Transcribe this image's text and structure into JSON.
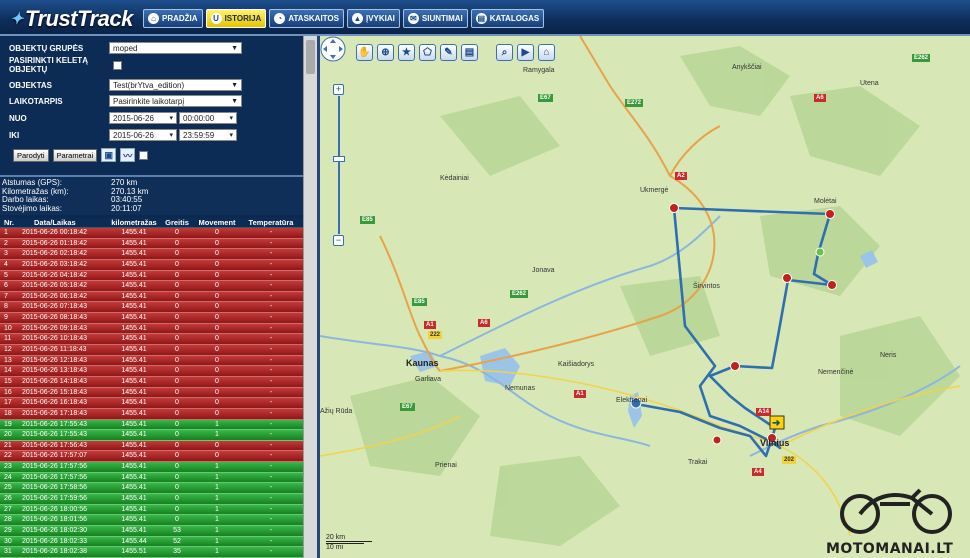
{
  "app": {
    "name": "TrustTrack"
  },
  "nav": [
    {
      "label": "PRADŽIA",
      "icon": "home-icon",
      "active": false
    },
    {
      "label": "ISTORIJA",
      "icon": "history-icon",
      "active": true
    },
    {
      "label": "ATASKAITOS",
      "icon": "report-icon",
      "active": false
    },
    {
      "label": "ĮVYKIAI",
      "icon": "alert-icon",
      "active": false
    },
    {
      "label": "SIUNTIMAI",
      "icon": "mail-icon",
      "active": false
    },
    {
      "label": "KATALOGAS",
      "icon": "catalog-icon",
      "active": false
    }
  ],
  "filters": {
    "group_label": "OBJEKTŲ GRUPĖS",
    "group_value": "moped",
    "multi_label": "PASIRINKTI KELETĄ OBJEKTŲ",
    "object_label": "OBJEKTAS",
    "object_value": "Test(brYtva_edition)",
    "period_label": "LAIKOTARPIS",
    "period_value": "Pasirinkite laikotarpį",
    "from_label": "NUO",
    "from_date": "2015-06-26",
    "from_time": "00:00:00",
    "to_label": "IKI",
    "to_date": "2015-06-26",
    "to_time": "23:59:59",
    "show_button": "Parodyti",
    "params_button": "Parametrai"
  },
  "stats": [
    {
      "key": "Atstumas (GPS):",
      "value": "270 km"
    },
    {
      "key": "Kilometražas (km):",
      "value": "270.13 km"
    },
    {
      "key": "Darbo laikas:",
      "value": "03:40:55"
    },
    {
      "key": "Stovėjimo laikas:",
      "value": "20:11:07"
    }
  ],
  "table": {
    "headers": [
      "Nr.",
      "Data/Laikas",
      "kilometražas",
      "Greitis",
      "Movement",
      "Temperatūra"
    ],
    "rows": [
      {
        "nr": "1",
        "dt": "2015-06-26 00:18:42",
        "km": "1455.41",
        "speed": "0",
        "mov": "0",
        "temp": "-",
        "status": "red"
      },
      {
        "nr": "2",
        "dt": "2015-06-26 01:18:42",
        "km": "1455.41",
        "speed": "0",
        "mov": "0",
        "temp": "-",
        "status": "red"
      },
      {
        "nr": "3",
        "dt": "2015-06-26 02:18:42",
        "km": "1455.41",
        "speed": "0",
        "mov": "0",
        "temp": "-",
        "status": "red"
      },
      {
        "nr": "4",
        "dt": "2015-06-26 03:18:42",
        "km": "1455.41",
        "speed": "0",
        "mov": "0",
        "temp": "-",
        "status": "red"
      },
      {
        "nr": "5",
        "dt": "2015-06-26 04:18:42",
        "km": "1455.41",
        "speed": "0",
        "mov": "0",
        "temp": "-",
        "status": "red"
      },
      {
        "nr": "6",
        "dt": "2015-06-26 05:18:42",
        "km": "1455.41",
        "speed": "0",
        "mov": "0",
        "temp": "-",
        "status": "red"
      },
      {
        "nr": "7",
        "dt": "2015-06-26 06:18:42",
        "km": "1455.41",
        "speed": "0",
        "mov": "0",
        "temp": "-",
        "status": "red"
      },
      {
        "nr": "8",
        "dt": "2015-06-26 07:18:43",
        "km": "1455.41",
        "speed": "0",
        "mov": "0",
        "temp": "-",
        "status": "red"
      },
      {
        "nr": "9",
        "dt": "2015-06-26 08:18:43",
        "km": "1455.41",
        "speed": "0",
        "mov": "0",
        "temp": "-",
        "status": "red"
      },
      {
        "nr": "10",
        "dt": "2015-06-26 09:18:43",
        "km": "1455.41",
        "speed": "0",
        "mov": "0",
        "temp": "-",
        "status": "red"
      },
      {
        "nr": "11",
        "dt": "2015-06-26 10:18:43",
        "km": "1455.41",
        "speed": "0",
        "mov": "0",
        "temp": "-",
        "status": "red"
      },
      {
        "nr": "12",
        "dt": "2015-06-26 11:18:43",
        "km": "1455.41",
        "speed": "0",
        "mov": "0",
        "temp": "-",
        "status": "red"
      },
      {
        "nr": "13",
        "dt": "2015-06-26 12:18:43",
        "km": "1455.41",
        "speed": "0",
        "mov": "0",
        "temp": "-",
        "status": "red"
      },
      {
        "nr": "14",
        "dt": "2015-06-26 13:18:43",
        "km": "1455.41",
        "speed": "0",
        "mov": "0",
        "temp": "-",
        "status": "red"
      },
      {
        "nr": "15",
        "dt": "2015-06-26 14:18:43",
        "km": "1455.41",
        "speed": "0",
        "mov": "0",
        "temp": "-",
        "status": "red"
      },
      {
        "nr": "16",
        "dt": "2015-06-26 15:18:43",
        "km": "1455.41",
        "speed": "0",
        "mov": "0",
        "temp": "-",
        "status": "red"
      },
      {
        "nr": "17",
        "dt": "2015-06-26 16:18:43",
        "km": "1455.41",
        "speed": "0",
        "mov": "0",
        "temp": "-",
        "status": "red"
      },
      {
        "nr": "18",
        "dt": "2015-06-26 17:18:43",
        "km": "1455.41",
        "speed": "0",
        "mov": "0",
        "temp": "-",
        "status": "red"
      },
      {
        "nr": "19",
        "dt": "2015-06-26 17:55:43",
        "km": "1455.41",
        "speed": "0",
        "mov": "1",
        "temp": "-",
        "status": "green"
      },
      {
        "nr": "20",
        "dt": "2015-06-26 17:55:43",
        "km": "1455.41",
        "speed": "0",
        "mov": "1",
        "temp": "-",
        "status": "green"
      },
      {
        "nr": "21",
        "dt": "2015-06-26 17:56:43",
        "km": "1455.41",
        "speed": "0",
        "mov": "0",
        "temp": "-",
        "status": "red"
      },
      {
        "nr": "22",
        "dt": "2015-06-26 17:57:07",
        "km": "1455.41",
        "speed": "0",
        "mov": "0",
        "temp": "-",
        "status": "red"
      },
      {
        "nr": "23",
        "dt": "2015-06-26 17:57:56",
        "km": "1455.41",
        "speed": "0",
        "mov": "1",
        "temp": "-",
        "status": "green"
      },
      {
        "nr": "24",
        "dt": "2015-06-26 17:57:56",
        "km": "1455.41",
        "speed": "0",
        "mov": "1",
        "temp": "-",
        "status": "green"
      },
      {
        "nr": "25",
        "dt": "2015-06-26 17:58:56",
        "km": "1455.41",
        "speed": "0",
        "mov": "1",
        "temp": "-",
        "status": "green"
      },
      {
        "nr": "26",
        "dt": "2015-06-26 17:59:56",
        "km": "1455.41",
        "speed": "0",
        "mov": "1",
        "temp": "-",
        "status": "green"
      },
      {
        "nr": "27",
        "dt": "2015-06-26 18:00:56",
        "km": "1455.41",
        "speed": "0",
        "mov": "1",
        "temp": "-",
        "status": "green"
      },
      {
        "nr": "28",
        "dt": "2015-06-26 18:01:56",
        "km": "1455.41",
        "speed": "0",
        "mov": "1",
        "temp": "-",
        "status": "green"
      },
      {
        "nr": "29",
        "dt": "2015-06-26 18:02:30",
        "km": "1455.41",
        "speed": "53",
        "mov": "1",
        "temp": "-",
        "status": "green"
      },
      {
        "nr": "30",
        "dt": "2015-06-26 18:02:33",
        "km": "1455.44",
        "speed": "52",
        "mov": "1",
        "temp": "-",
        "status": "green"
      },
      {
        "nr": "31",
        "dt": "2015-06-26 18:02:38",
        "km": "1455.51",
        "speed": "35",
        "mov": "1",
        "temp": "-",
        "status": "green"
      }
    ]
  },
  "map": {
    "cities": [
      "Vilnius",
      "Kaunas"
    ],
    "places": [
      "Ramygala",
      "Anykščiai",
      "Utena",
      "Kėdainiai",
      "Ukmergė",
      "Molėtai",
      "Jonava",
      "Širvintos",
      "Kaišiadorys",
      "Garliava",
      "Nemunas",
      "Elektrėnai",
      "Trakai",
      "Prienai",
      "Nemenčinė",
      "Neris",
      "Ažių Rūda"
    ],
    "scale_top": "20 km",
    "scale_bottom": "10 mi",
    "watermark": "MOTOMANAI.LT"
  },
  "tools": [
    "pan-hand-icon",
    "zoom-in-tool-icon",
    "favorite-icon",
    "polygon-icon",
    "edit-icon",
    "print-icon",
    "search-tool-icon",
    "play-icon",
    "home-map-icon"
  ]
}
